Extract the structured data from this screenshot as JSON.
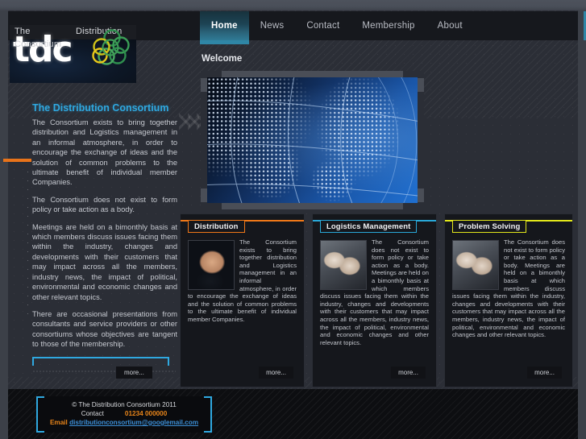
{
  "site": {
    "logo": {
      "line1_left": "The",
      "line1_right": "Distribution",
      "line2": "Consortium",
      "wordmark": "tdc"
    },
    "nav": [
      {
        "label": "Home",
        "active": true
      },
      {
        "label": "News",
        "active": false
      },
      {
        "label": "Contact",
        "active": false
      },
      {
        "label": "Membership",
        "active": false
      },
      {
        "label": "About",
        "active": false
      }
    ]
  },
  "left_column": {
    "title": "The Distribution Consortium",
    "paragraphs": [
      "The Consortium exists to bring together distribution and Logistics management in an informal atmosphere, in order to encourage the exchange of ideas and the solution of common problems to the ultimate benefit of individual member Companies.",
      "The Consortium does not exist to form policy or take action as a body.",
      "Meetings are held on a bimonthly basis at which members discuss issues facing them within the industry, changes and developments with their customers that may impact across all the members, industry news, the impact of political, environmental and economic changes and other relevant topics.",
      "There are occasional presentations from consultants and service providers or other consortiums whose objectives are tangent to those of the membership."
    ],
    "more_label": "more..."
  },
  "main": {
    "heading": "Welcome",
    "hero_alt": "globe-world-map-banner"
  },
  "panels": [
    {
      "title": "Distribution",
      "accent": "#f07818",
      "image_alt": "man-on-phone-photo",
      "text": "The Consortium exists to bring together distribution and Logistics management in an informal atmosphere, in order to encourage the exchange of ideas and the solution of common problems to the ultimate benefit of individual member Companies.",
      "more_label": "more..."
    },
    {
      "title": "Logistics Management",
      "accent": "#29a8d8",
      "image_alt": "hands-on-keyboard-photo",
      "text": "The Consortium does not exist to form policy or take action as a body.\n\nMeetings are held on a bimonthly basis at which members discuss issues facing them within the industry, changes and developments with their customers that may impact across all the members, industry news, the impact of political, environmental and economic changes and other relevant topics.",
      "more_label": "more..."
    },
    {
      "title": "Problem Solving",
      "accent": "#e3e81a",
      "image_alt": "hands-on-keyboard-photo",
      "text": "The Consortium does not exist to form policy or take action as a body.\n\nMeetings are held on a bimonthly basis at which members discuss issues facing them within the industry, changes and developments with their customers that may impact across all the members, industry news, the impact of political, environmental and economic changes and other relevant topics.",
      "more_label": "more..."
    }
  ],
  "footer": {
    "copyright": "© The Distribution Consortium 2011",
    "contact_label": "Contact",
    "phone": "01234 000000",
    "email_label": "Email",
    "email": "distributionconsortium@googlemail.com"
  },
  "colors": {
    "page_bg": "#3c4048",
    "body_bg": "#2b2e36",
    "header_bg": "#16181d",
    "accent_blue": "#2fa8e0",
    "accent_orange": "#e8731a",
    "nav_active": "#2f7a96",
    "panel_bg": "#15171c"
  }
}
